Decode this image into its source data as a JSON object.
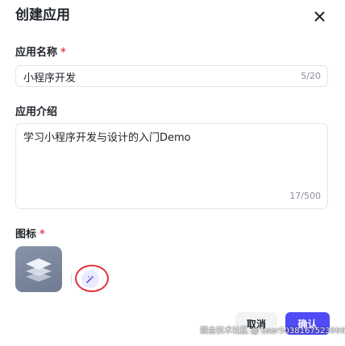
{
  "dialog": {
    "title": "创建应用",
    "close_icon": "close-icon"
  },
  "name_field": {
    "label": "应用名称",
    "required_mark": "*",
    "value": "小程序开发",
    "count": "5/20"
  },
  "intro_field": {
    "label": "应用介绍",
    "value": "学习小程序开发与设计的入门Demo",
    "count": "17/500"
  },
  "icon_field": {
    "label": "图标",
    "required_mark": "*",
    "icon": "layers-icon",
    "generate_icon": "magic-wand-icon",
    "highlight_color": "#e0303a"
  },
  "footer": {
    "cancel_label": "取消",
    "confirm_label": "确认"
  },
  "watermark": "掘金技术社区 @ user5038167523996",
  "colors": {
    "accent": "#4f4cf5",
    "required": "#e5484d"
  }
}
